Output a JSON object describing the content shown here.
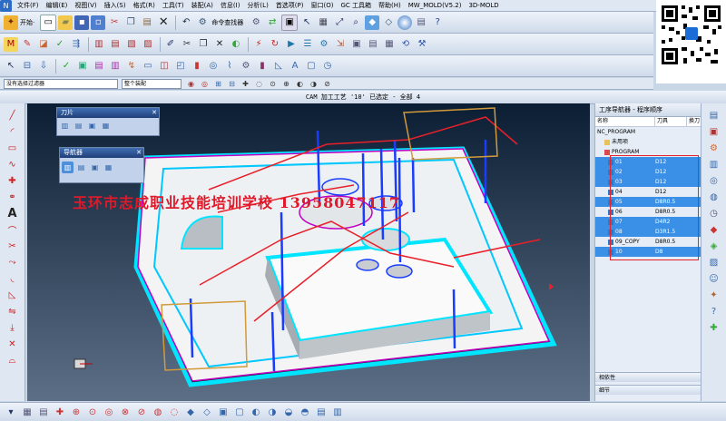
{
  "menu": [
    "文件(F)",
    "编辑(E)",
    "视图(V)",
    "插入(S)",
    "格式(R)",
    "工具(T)",
    "装配(A)",
    "信息(I)",
    "分析(L)",
    "首选项(P)",
    "窗口(O)",
    "GC 工具箱",
    "帮助(H)",
    "MW_MOLD(V5.2)",
    "3D-MOLD"
  ],
  "toolbar": {
    "start_label": "开始·",
    "command_finder_label": "命令查找器"
  },
  "filter": {
    "selection_filter": "没有选择过滤器",
    "assembly_scope": "整个装配"
  },
  "viewport": {
    "title": "CAM 加工工艺 '10' 已选定 - 全部 4",
    "watermark": "玉环市志成职业技能培训学校 13958047117"
  },
  "tool_panel": {
    "title": "刀片"
  },
  "navigator_panel": {
    "title": "导航器"
  },
  "operation_navigator": {
    "title": "工序导航器 - 程序顺序",
    "columns": [
      "名称",
      "刀具",
      "换刀"
    ],
    "root": "NC_PROGRAM",
    "unused": "未用项",
    "program": "PROGRAM",
    "rows": [
      {
        "name": "01",
        "tool": "D12",
        "selected": true
      },
      {
        "name": "02",
        "tool": "D12",
        "selected": true
      },
      {
        "name": "03",
        "tool": "D12",
        "selected": true
      },
      {
        "name": "04",
        "tool": "D12",
        "selected": false
      },
      {
        "name": "05",
        "tool": "D8R0.5",
        "selected": true
      },
      {
        "name": "06",
        "tool": "D8R0.5",
        "selected": false
      },
      {
        "name": "07",
        "tool": "D4R2",
        "selected": true
      },
      {
        "name": "08",
        "tool": "D3R1.5",
        "selected": true
      },
      {
        "name": "09_COPY",
        "tool": "D8R0.5",
        "selected": false
      },
      {
        "name": "10",
        "tool": "D8",
        "selected": true
      }
    ],
    "footer_dependencies": "相依性",
    "footer_details": "细节"
  },
  "colors": {
    "selection": "#3a8fe6",
    "toolpath_red": "#e8202a",
    "part_face": "#f4f4f4",
    "stock_cyan": "#00e5ff"
  }
}
